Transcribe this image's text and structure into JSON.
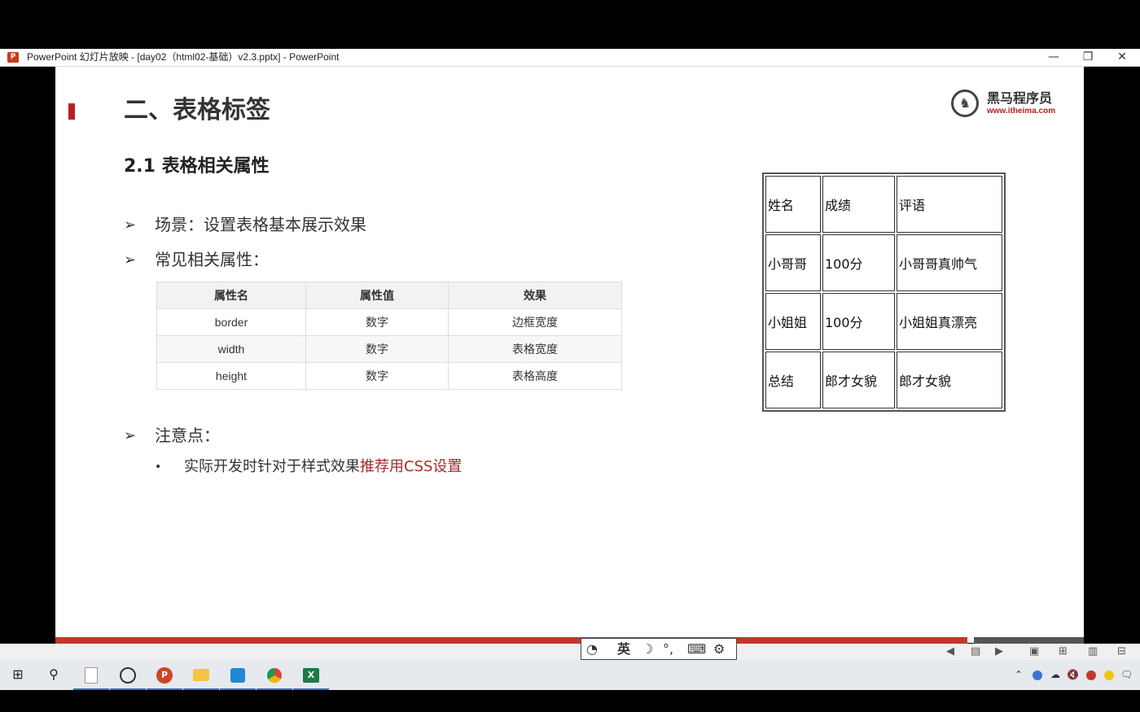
{
  "window": {
    "title": "PowerPoint 幻灯片放映 - [day02（html02-基础）v2.3.pptx] - PowerPoint",
    "app_icon_letter": "P",
    "minimize": "—",
    "restore": "❐",
    "close": "✕"
  },
  "slide": {
    "title": "二、表格标签",
    "logo": {
      "name": "黑马程序员",
      "url": "www.itheima.com"
    },
    "subtitle": "2.1 表格相关属性",
    "bullets": [
      {
        "arrow": "➢",
        "text": "场景：设置表格基本展示效果"
      },
      {
        "arrow": "➢",
        "text": "常见相关属性："
      },
      {
        "arrow": "➢",
        "text": "注意点："
      }
    ],
    "note": {
      "dot": "•",
      "text_plain": "实际开发时针对于样式效果",
      "text_highlight": "推荐用CSS设置"
    },
    "attr_table": {
      "headers": [
        "属性名",
        "属性值",
        "效果"
      ],
      "rows": [
        [
          "border",
          "数字",
          "边框宽度"
        ],
        [
          "width",
          "数字",
          "表格宽度"
        ],
        [
          "height",
          "数字",
          "表格高度"
        ]
      ]
    },
    "demo_table": {
      "rows": [
        [
          "姓名",
          "成绩",
          "评语"
        ],
        [
          "小哥哥",
          "100分",
          "小哥哥真帅气"
        ],
        [
          "小姐姐",
          "100分",
          "小姐姐真漂亮"
        ],
        [
          "总结",
          "郎才女貌",
          "郎才女貌"
        ]
      ]
    }
  },
  "ime_toolbar": {
    "mode": "英",
    "moon": "☽",
    "punct": "°,",
    "keyboard": "⌨",
    "settings": "⚙"
  },
  "status_icons": [
    "◀",
    "▤",
    "▶",
    "▣",
    "⊞",
    "▥",
    "⊟"
  ],
  "taskbar": {
    "start": "⊞",
    "search": "⚲",
    "apps": [
      "file-icon",
      "clock-icon",
      "powerpoint-icon",
      "folder-icon",
      "vscode-icon",
      "chrome-icon",
      "excel-icon"
    ]
  },
  "tray": {
    "chevron": "⌃",
    "volume": "🔇",
    "notification": "🗨"
  },
  "colors": {
    "accent_red": "#c0392b",
    "title_bar": "#ffffff",
    "desktop": "#000000"
  }
}
